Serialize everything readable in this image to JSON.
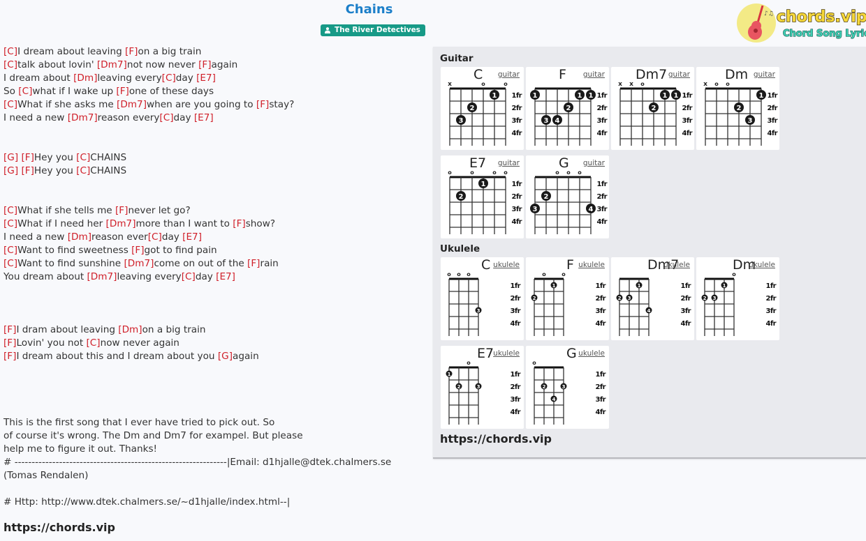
{
  "song": {
    "title": "Chains",
    "artist": "The River Detectives",
    "artist_icon": "user-icon"
  },
  "logo": {
    "brand": "chords.vip",
    "tagline": "Chord Song Lyric",
    "icon": "guitar-icon"
  },
  "lyrics": [
    [
      {
        "c": "C"
      },
      {
        "t": "I dream about leaving "
      },
      {
        "c": "F"
      },
      {
        "t": "on a big train"
      }
    ],
    [
      {
        "c": "C"
      },
      {
        "t": "talk about lovin' "
      },
      {
        "c": "Dm7"
      },
      {
        "t": "not now never "
      },
      {
        "c": "F"
      },
      {
        "t": "again"
      }
    ],
    [
      {
        "t": "I dream about "
      },
      {
        "c": "Dm"
      },
      {
        "t": "leaving every"
      },
      {
        "c": "C"
      },
      {
        "t": "day "
      },
      {
        "c": "E7"
      }
    ],
    [
      {
        "t": "So "
      },
      {
        "c": "C"
      },
      {
        "t": "what if I wake up "
      },
      {
        "c": "F"
      },
      {
        "t": "one of these days"
      }
    ],
    [
      {
        "c": "C"
      },
      {
        "t": "What if she asks me "
      },
      {
        "c": "Dm7"
      },
      {
        "t": "when are you going to "
      },
      {
        "c": "F"
      },
      {
        "t": "stay?"
      }
    ],
    [
      {
        "t": "I need a new "
      },
      {
        "c": "Dm7"
      },
      {
        "t": "reason every"
      },
      {
        "c": "C"
      },
      {
        "t": "day "
      },
      {
        "c": "E7"
      }
    ],
    [],
    [],
    [
      {
        "c": "G"
      },
      {
        "t": " "
      },
      {
        "c": "F"
      },
      {
        "t": "Hey you "
      },
      {
        "c": "C"
      },
      {
        "t": "CHAINS"
      }
    ],
    [
      {
        "c": "G"
      },
      {
        "t": " "
      },
      {
        "c": "F"
      },
      {
        "t": "Hey you "
      },
      {
        "c": "C"
      },
      {
        "t": "CHAINS"
      }
    ],
    [],
    [],
    [
      {
        "c": "C"
      },
      {
        "t": "What if she tells me "
      },
      {
        "c": "F"
      },
      {
        "t": "never let go?"
      }
    ],
    [
      {
        "c": "C"
      },
      {
        "t": "What if I need her "
      },
      {
        "c": "Dm7"
      },
      {
        "t": "more than I want to "
      },
      {
        "c": "F"
      },
      {
        "t": "show?"
      }
    ],
    [
      {
        "t": "I need a new "
      },
      {
        "c": "Dm"
      },
      {
        "t": "reason ever"
      },
      {
        "c": "C"
      },
      {
        "t": "day "
      },
      {
        "c": "E7"
      }
    ],
    [
      {
        "c": "C"
      },
      {
        "t": "Want to find sweetness "
      },
      {
        "c": "F"
      },
      {
        "t": "got to find pain"
      }
    ],
    [
      {
        "c": "C"
      },
      {
        "t": "Want to find sunshine "
      },
      {
        "c": "Dm7"
      },
      {
        "t": "come on out of the "
      },
      {
        "c": "F"
      },
      {
        "t": "rain"
      }
    ],
    [
      {
        "t": "You dream about "
      },
      {
        "c": "Dm7"
      },
      {
        "t": "leaving every"
      },
      {
        "c": "C"
      },
      {
        "t": "day "
      },
      {
        "c": "E7"
      }
    ],
    [],
    [],
    [],
    [
      {
        "c": "F"
      },
      {
        "t": "I dram about leaving "
      },
      {
        "c": "Dm"
      },
      {
        "t": "on a big train"
      }
    ],
    [
      {
        "c": "F"
      },
      {
        "t": "Lovin' you not "
      },
      {
        "c": "C"
      },
      {
        "t": "now never again"
      }
    ],
    [
      {
        "c": "F"
      },
      {
        "t": "I dream about this and I dream about you "
      },
      {
        "c": "G"
      },
      {
        "t": "again"
      }
    ],
    [],
    [],
    [],
    [],
    [
      {
        "t": "This is the first song that I ever have tried to pick out. So"
      }
    ],
    [
      {
        "t": "of course it's wrong. The Dm and Dm7 for exampel. But please"
      }
    ],
    [
      {
        "t": "help me to figure it out. Thanks!"
      }
    ],
    [
      {
        "t": "# --------------------------------------------------------------|Email: d1hjalle@dtek.chalmers.se"
      }
    ],
    [
      {
        "t": "(Tomas Rendalen)"
      }
    ],
    [],
    [
      {
        "t": "# Http: http://www.dtek.chalmers.se/~d1hjalle/index.html--|"
      }
    ]
  ],
  "footer_url": "https://chords.vip",
  "chord_panel": {
    "guitar_heading": "Guitar",
    "ukulele_heading": "Ukulele",
    "url": "https://chords.vip",
    "fret_labels": [
      "1fr",
      "2fr",
      "3fr",
      "4fr"
    ],
    "guitar": [
      {
        "name": "C",
        "link": "guitar",
        "top": [
          "x",
          "",
          "",
          "o",
          "",
          "o"
        ],
        "dots": [
          [
            4,
            1,
            "1"
          ],
          [
            2,
            2,
            "2"
          ],
          [
            1,
            3,
            "3"
          ]
        ]
      },
      {
        "name": "F",
        "link": "guitar",
        "top": [
          "",
          "",
          "",
          "",
          "",
          ""
        ],
        "dots": [
          [
            0,
            1,
            "1"
          ],
          [
            4,
            1,
            "1"
          ],
          [
            5,
            1,
            "1"
          ],
          [
            3,
            2,
            "2"
          ],
          [
            1,
            3,
            "3"
          ],
          [
            2,
            3,
            "4"
          ]
        ]
      },
      {
        "name": "Dm7",
        "link": "guitar",
        "top": [
          "x",
          "x",
          "o",
          "",
          "",
          ""
        ],
        "dots": [
          [
            4,
            1,
            "1"
          ],
          [
            5,
            1,
            "1"
          ],
          [
            3,
            2,
            "2"
          ]
        ]
      },
      {
        "name": "Dm",
        "link": "guitar",
        "top": [
          "x",
          "o",
          "o",
          "",
          "",
          ""
        ],
        "dots": [
          [
            5,
            1,
            "1"
          ],
          [
            3,
            2,
            "2"
          ],
          [
            4,
            3,
            "3"
          ]
        ]
      },
      {
        "name": "E7",
        "link": "guitar",
        "top": [
          "o",
          "",
          "o",
          "",
          "o",
          "o"
        ],
        "dots": [
          [
            3,
            1,
            "1"
          ],
          [
            1,
            2,
            "2"
          ]
        ]
      },
      {
        "name": "G",
        "link": "guitar",
        "top": [
          "",
          "",
          "o",
          "o",
          "o",
          ""
        ],
        "dots": [
          [
            1,
            2,
            "2"
          ],
          [
            0,
            3,
            "3"
          ],
          [
            5,
            3,
            "4"
          ]
        ]
      }
    ],
    "ukulele": [
      {
        "name": "C",
        "link": "ukulele",
        "top": [
          "o",
          "o",
          "o",
          ""
        ],
        "dots": [
          [
            3,
            3,
            "3"
          ]
        ]
      },
      {
        "name": "F",
        "link": "ukulele",
        "top": [
          "",
          "o",
          "",
          "o"
        ],
        "dots": [
          [
            2,
            1,
            "1"
          ],
          [
            0,
            2,
            "2"
          ]
        ]
      },
      {
        "name": "Dm7",
        "link": "ukulele",
        "top": [
          "",
          "",
          "",
          ""
        ],
        "dots": [
          [
            2,
            1,
            "1"
          ],
          [
            0,
            2,
            "2"
          ],
          [
            1,
            2,
            "3"
          ],
          [
            3,
            3,
            "4"
          ]
        ]
      },
      {
        "name": "Dm",
        "link": "ukulele",
        "top": [
          "",
          "",
          "",
          "o"
        ],
        "dots": [
          [
            2,
            1,
            "1"
          ],
          [
            0,
            2,
            "2"
          ],
          [
            1,
            2,
            "3"
          ]
        ]
      },
      {
        "name": "E7",
        "link": "ukulele",
        "top": [
          "",
          "",
          "o",
          ""
        ],
        "dots": [
          [
            0,
            1,
            "1"
          ],
          [
            1,
            2,
            "2"
          ],
          [
            3,
            2,
            "3"
          ]
        ]
      },
      {
        "name": "G",
        "link": "ukulele",
        "top": [
          "o",
          "",
          "",
          ""
        ],
        "dots": [
          [
            1,
            2,
            "2"
          ],
          [
            3,
            2,
            "3"
          ],
          [
            2,
            3,
            "4"
          ]
        ]
      }
    ]
  }
}
